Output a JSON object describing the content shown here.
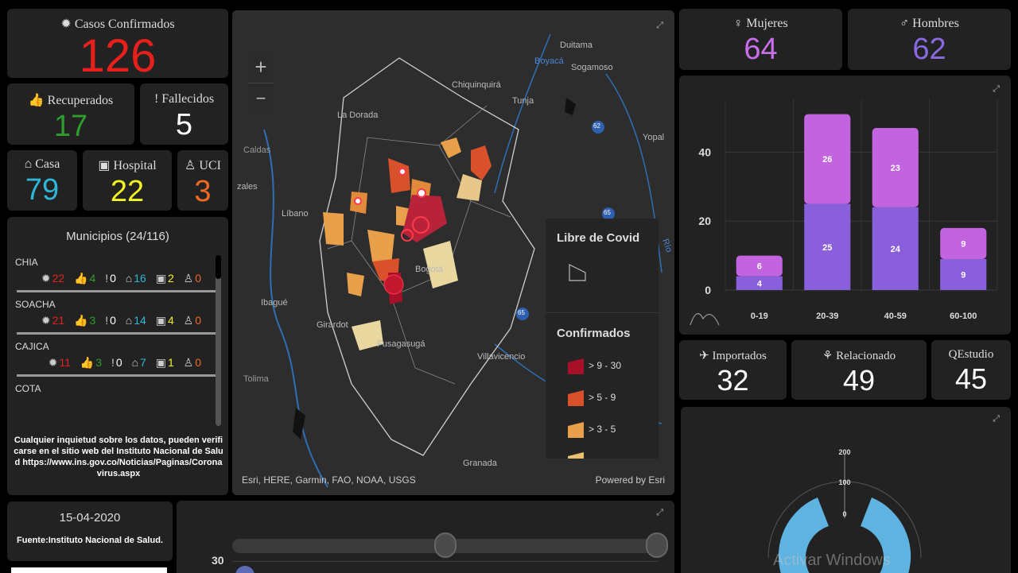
{
  "casos": {
    "icon": "virus-icon",
    "label": "Casos Confirmados",
    "value": "126",
    "color": "#e8201c"
  },
  "recuperados": {
    "icon": "thumbs-up-icon",
    "label": "Recuperados",
    "value": "17",
    "color": "#2e9d2e"
  },
  "fallecidos": {
    "icon": "exclamation-icon",
    "label": "Fallecidos",
    "value": "5",
    "color": "#ffffff"
  },
  "casa": {
    "icon": "home-icon",
    "label": "Casa",
    "value": "79",
    "color": "#2fb5d6"
  },
  "hospital": {
    "icon": "hospital-icon",
    "label": "Hospital",
    "value": "22",
    "color": "#f3f323"
  },
  "uci": {
    "icon": "patient-icon",
    "label": "UCI",
    "value": "3",
    "color": "#f06a23"
  },
  "municipios": {
    "title": "Municipios (24/116)",
    "items": [
      {
        "name": "CHIA",
        "confirmed": "22",
        "recovered": "4",
        "deaths": "0",
        "home": "16",
        "hospital": "2",
        "icu": "0"
      },
      {
        "name": "SOACHA",
        "confirmed": "21",
        "recovered": "3",
        "deaths": "0",
        "home": "14",
        "hospital": "4",
        "icu": "0"
      },
      {
        "name": "CAJICA",
        "confirmed": "11",
        "recovered": "3",
        "deaths": "0",
        "home": "7",
        "hospital": "1",
        "icu": "0"
      },
      {
        "name": "COTA"
      }
    ],
    "note": "Cualquier inquietud sobre los datos, pueden verificarse en el sitio web del Instituto Nacional de Salud https://www.ins.gov.co/Noticias/Paginas/Coronavirus.aspx"
  },
  "date_panel": {
    "date": "15-04-2020",
    "source": "Fuente:Instituto Nacional de Salud."
  },
  "map": {
    "zoom_in": "+",
    "zoom_out": "−",
    "attribution": "Esri, HERE, Garmin, FAO, NOAA, USGS",
    "powered": "Powered by Esri",
    "labels": [
      "Duitama",
      "Boyacá",
      "Sogamoso",
      "Chiquinquirá",
      "Tunja",
      "La Dorada",
      "Yopal",
      "Caldas",
      "zales",
      "Líbano",
      "Bogotá",
      "Ibagué",
      "Girardot",
      "Fusagasugá",
      "Villavicencio",
      "Tolima",
      "Granada",
      "62",
      "65",
      "65",
      "Río"
    ],
    "legend": {
      "free_title": "Libre de Covid",
      "confirmed_title": "Confirmados",
      "ranges": [
        {
          "label": "> 9 - 30",
          "color": "#a8102a"
        },
        {
          "label": "> 5 - 9",
          "color": "#d9512a"
        },
        {
          "label": "> 3 - 5",
          "color": "#e8a04a"
        }
      ]
    }
  },
  "mujeres": {
    "icon": "female-icon",
    "label": "Mujeres",
    "value": "64",
    "color": "#c86ee8"
  },
  "hombres": {
    "icon": "male-icon",
    "label": "Hombres",
    "value": "62",
    "color": "#8a6ae0"
  },
  "chart_data": [
    {
      "type": "bar",
      "stacked": true,
      "categories": [
        "0-19",
        "20-39",
        "40-59",
        "60-100"
      ],
      "series": [
        {
          "values": [
            4,
            25,
            24,
            9
          ],
          "color": "#8a5fdc"
        },
        {
          "values": [
            6,
            26,
            23,
            9
          ],
          "color": "#c264e0"
        }
      ],
      "yticks": [
        0,
        20,
        40
      ],
      "ylim": [
        0,
        53
      ]
    },
    {
      "type": "gauge",
      "ticks": [
        "200",
        "100",
        "0"
      ]
    },
    {
      "type": "line",
      "yticks": [
        "30"
      ]
    }
  ],
  "importados": {
    "icon": "plane-icon",
    "label": "Importados",
    "value": "32"
  },
  "relacionado": {
    "icon": "network-icon",
    "label": "Relacionado",
    "value": "49"
  },
  "estudio": {
    "icon": "magnifier-icon",
    "label": "Estudio",
    "value": "45"
  },
  "watermark": "Activar Windows"
}
